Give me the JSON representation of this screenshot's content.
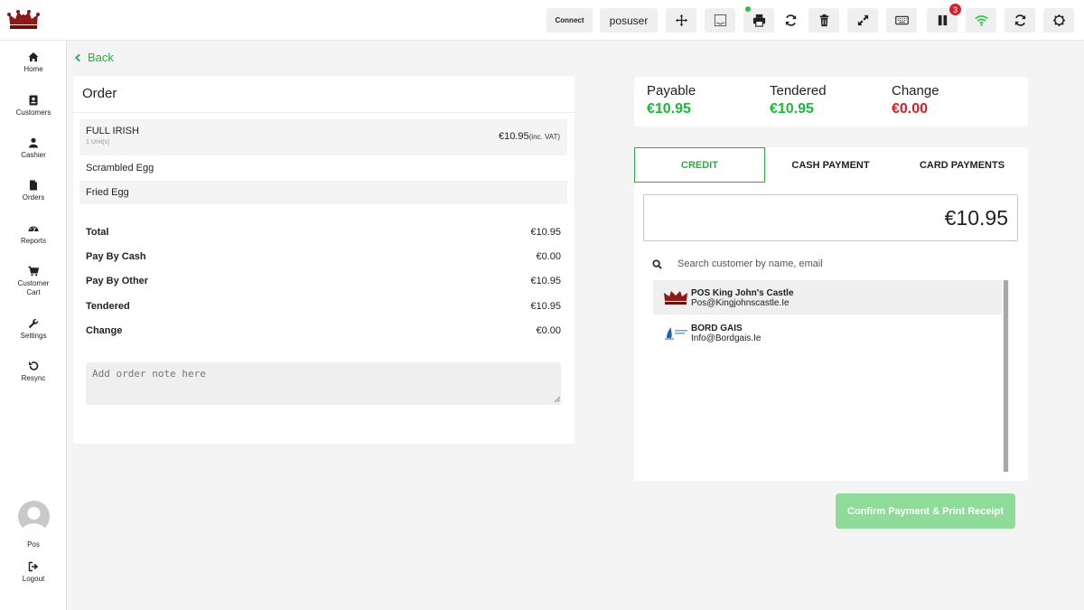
{
  "topbar": {
    "connect_label": "Connect",
    "user_label": "posuser",
    "notification_count": "3",
    "icons": [
      "move-icon",
      "drawer-icon",
      "printer-icon",
      "refresh-print-icon",
      "trash-icon",
      "expand-icon",
      "keyboard-icon",
      "pause-icon",
      "wifi-icon",
      "sync-icon",
      "settings-icon"
    ],
    "wifi_color": "#2ec24a"
  },
  "sidebar": {
    "items": [
      {
        "label": "Home",
        "icon": "home-icon"
      },
      {
        "label": "Customers",
        "icon": "contacts-icon"
      },
      {
        "label": "Cashier",
        "icon": "user-icon"
      },
      {
        "label": "Orders",
        "icon": "file-icon"
      },
      {
        "label": "Reports",
        "icon": "dashboard-icon"
      },
      {
        "label": "Customer Cart",
        "icon": "cart-icon"
      },
      {
        "label": "Settings",
        "icon": "wrench-icon"
      },
      {
        "label": "Resync",
        "icon": "undo-icon"
      }
    ],
    "user_name": "Pos",
    "logout_label": "Logout"
  },
  "back_label": "Back",
  "order": {
    "title": "Order",
    "item": {
      "name": "FULL IRISH",
      "units": "1 Unit(s)",
      "price": "€10.95",
      "price_suffix": "(inc. VAT)"
    },
    "modifiers": [
      "Scrambled Egg",
      "Fried Egg"
    ],
    "summary": [
      {
        "label": "Total",
        "value": "€10.95"
      },
      {
        "label": "Pay By Cash",
        "value": "€0.00"
      },
      {
        "label": "Pay By Other",
        "value": "€10.95"
      },
      {
        "label": "Tendered",
        "value": "€10.95"
      },
      {
        "label": "Change",
        "value": "€0.00"
      }
    ],
    "note_placeholder": "Add order note here"
  },
  "totals": {
    "payable_label": "Payable",
    "payable_value": "€10.95",
    "tendered_label": "Tendered",
    "tendered_value": "€10.95",
    "change_label": "Change",
    "change_value": "€0.00",
    "green": "#1fb83a",
    "red": "#d7202c"
  },
  "payment": {
    "tabs": [
      "CREDIT",
      "CASH PAYMENT",
      "CARD PAYMENTS"
    ],
    "active_tab": "CREDIT",
    "amount": "€10.95",
    "search_placeholder": "Search customer by name, email",
    "customers": [
      {
        "name": "POS King John's Castle",
        "email": "Pos@Kingjohnscastle.Ie"
      },
      {
        "name": "BORD GAIS",
        "email": "Info@Bordgais.Ie"
      }
    ],
    "confirm_label": "Confirm Payment & Print Receipt",
    "accent": "#2ea94a"
  }
}
